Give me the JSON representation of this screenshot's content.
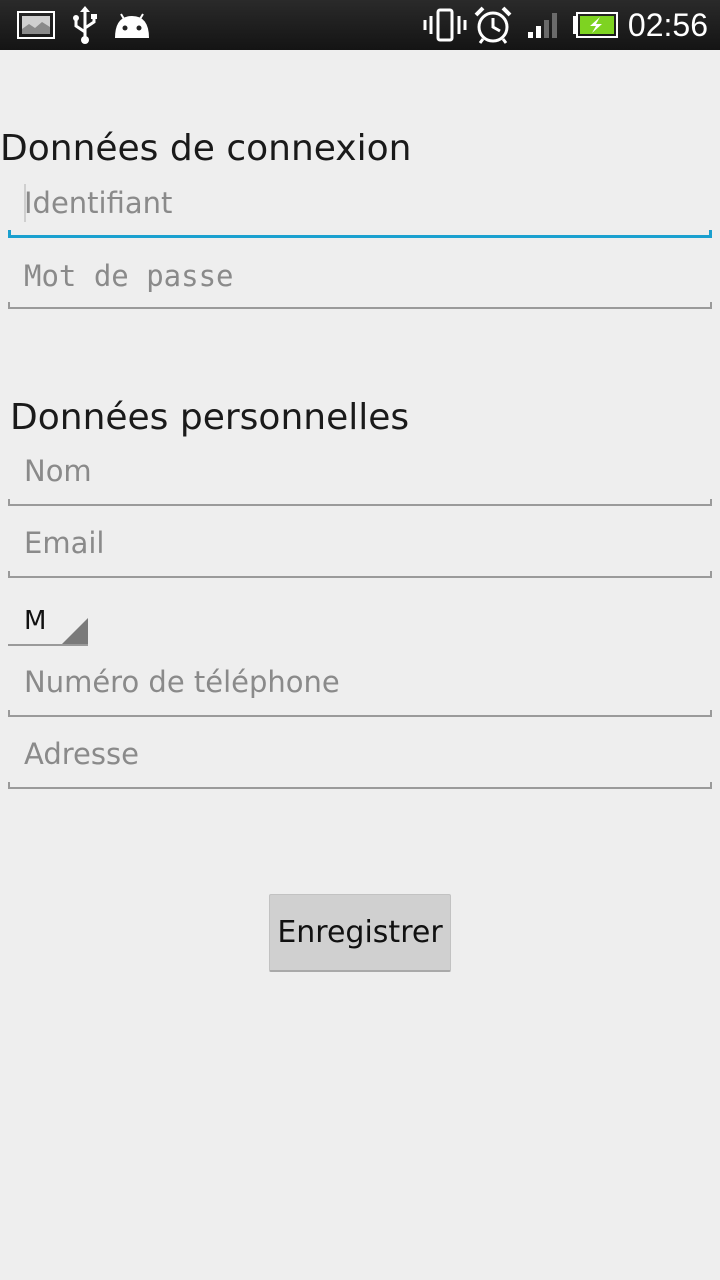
{
  "status_bar": {
    "time": "02:56",
    "icons": [
      "image-notification-icon",
      "usb-icon",
      "android-debug-icon",
      "vibrate-icon",
      "alarm-icon",
      "signal-icon",
      "battery-charging-icon"
    ]
  },
  "login_section": {
    "title": "Données de connexion",
    "identifier_placeholder": "Identifiant",
    "password_placeholder": "Mot de passe"
  },
  "personal_section": {
    "title": "Données personnelles",
    "name_placeholder": "Nom",
    "email_placeholder": "Email",
    "gender_selected": "M",
    "phone_placeholder": "Numéro de téléphone",
    "address_placeholder": "Adresse"
  },
  "actions": {
    "save_label": "Enregistrer"
  },
  "colors": {
    "focus_accent": "#1aa0cf",
    "background": "#eeeeee",
    "battery_green": "#7ed321"
  }
}
